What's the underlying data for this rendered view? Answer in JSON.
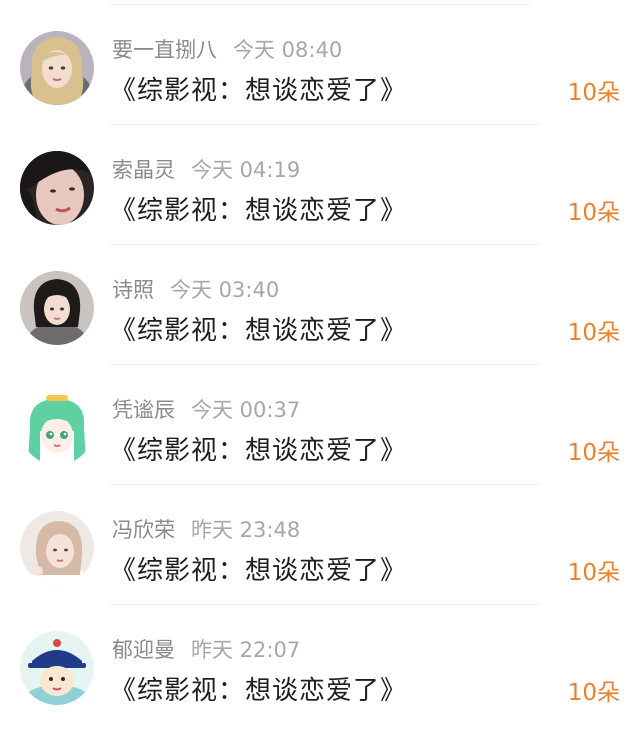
{
  "colors": {
    "amount": "#f07f2c",
    "username": "#8a8a8a",
    "time": "#a7a7a7",
    "title": "#1f1f1f"
  },
  "items": [
    {
      "username": "要一直捌八",
      "time": "今天 08:40",
      "title": "《综影视：想谈恋爱了》",
      "amount": "10朵",
      "avatar_icon": "avatar-girl-blonde-icon"
    },
    {
      "username": "索晶灵",
      "time": "今天 04:19",
      "title": "《综影视：想谈恋爱了》",
      "amount": "10朵",
      "avatar_icon": "avatar-dark-hair-closeup-icon"
    },
    {
      "username": "诗照",
      "time": "今天 03:40",
      "title": "《综影视：想谈恋爱了》",
      "amount": "10朵",
      "avatar_icon": "avatar-girl-grey-top-icon"
    },
    {
      "username": "凭谧辰",
      "time": "今天 00:37",
      "title": "《综影视：想谈恋爱了》",
      "amount": "10朵",
      "avatar_icon": "avatar-anime-green-hair-icon"
    },
    {
      "username": "冯欣荣",
      "time": "昨天 23:48",
      "title": "《综影视：想谈恋爱了》",
      "amount": "10朵",
      "avatar_icon": "avatar-girl-light-photo-icon"
    },
    {
      "username": "郁迎曼",
      "time": "昨天 22:07",
      "title": "《综影视：想谈恋爱了》",
      "amount": "10朵",
      "avatar_icon": "avatar-cartoon-qing-official-icon"
    }
  ]
}
